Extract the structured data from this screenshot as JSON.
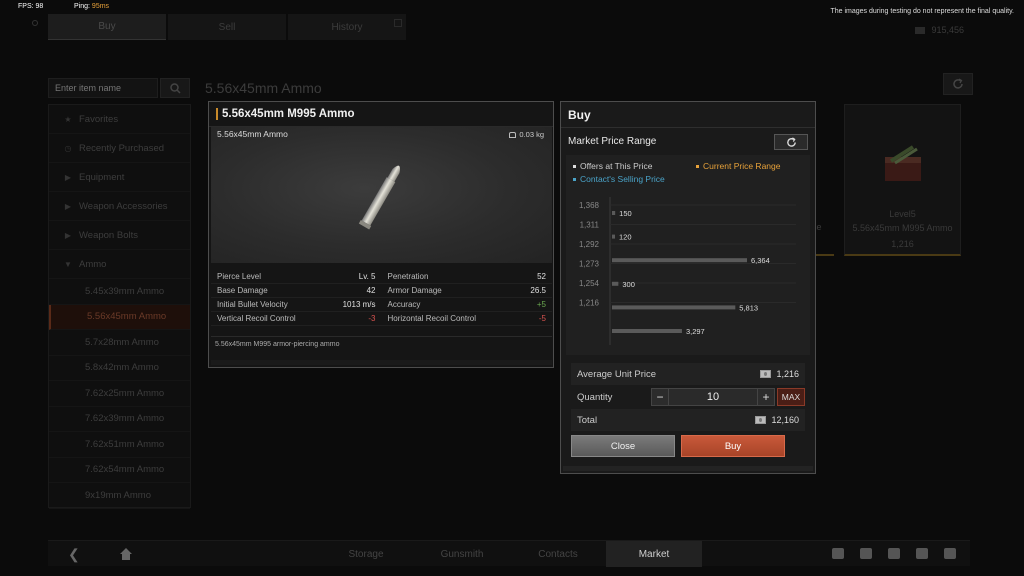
{
  "debug": {
    "fps_label": "FPS: 98",
    "ping_label": "Ping:",
    "ping_value": "95ms",
    "disclaimer": "The images during testing do not represent the final quality."
  },
  "top_tabs": [
    {
      "label": "Buy",
      "active": true
    },
    {
      "label": "Sell",
      "active": false
    },
    {
      "label": "History",
      "active": false
    }
  ],
  "balance": "915,456",
  "search": {
    "placeholder": "Enter item name"
  },
  "page_title": "5.56x45mm Ammo",
  "sidebar": {
    "items": [
      {
        "label": "Favorites",
        "icon": "star-icon"
      },
      {
        "label": "Recently Purchased",
        "icon": "clock-icon"
      },
      {
        "label": "Equipment",
        "icon": "caret-right-icon"
      },
      {
        "label": "Weapon Accessories",
        "icon": "caret-right-icon"
      },
      {
        "label": "Weapon Bolts",
        "icon": "caret-right-icon"
      },
      {
        "label": "Ammo",
        "icon": "caret-down-icon"
      }
    ],
    "ammo_items": [
      {
        "label": "5.45x39mm Ammo",
        "selected": false
      },
      {
        "label": "5.56x45mm Ammo",
        "selected": true
      },
      {
        "label": "5.7x28mm Ammo",
        "selected": false
      },
      {
        "label": "5.8x42mm Ammo",
        "selected": false
      },
      {
        "label": "7.62x25mm Ammo",
        "selected": false
      },
      {
        "label": "7.62x39mm Ammo",
        "selected": false
      },
      {
        "label": "7.62x51mm Ammo",
        "selected": false
      },
      {
        "label": "7.62x54mm Ammo",
        "selected": false
      },
      {
        "label": "9x19mm Ammo",
        "selected": false
      }
    ]
  },
  "item_card": {
    "level": "Level5",
    "name": "5.56x45mm M995 Ammo",
    "price": "1,216",
    "partial_text": "ce"
  },
  "info": {
    "title": "5.56x45mm M995 Ammo",
    "subtitle": "5.56x45mm Ammo",
    "weight": "0.03 kg",
    "stats": [
      [
        {
          "label": "Pierce Level",
          "value": "Lv. 5",
          "tone": ""
        },
        {
          "label": "Penetration",
          "value": "52",
          "tone": ""
        }
      ],
      [
        {
          "label": "Base Damage",
          "value": "42",
          "tone": ""
        },
        {
          "label": "Armor Damage",
          "value": "26.5",
          "tone": ""
        }
      ],
      [
        {
          "label": "Initial Bullet Velocity",
          "value": "1013 m/s",
          "tone": ""
        },
        {
          "label": "Accuracy",
          "value": "+5",
          "tone": "pos"
        }
      ],
      [
        {
          "label": "Vertical Recoil Control",
          "value": "-3",
          "tone": "neg"
        },
        {
          "label": "Horizontal Recoil Control",
          "value": "-5",
          "tone": "neg"
        }
      ]
    ],
    "description": "5.56x45mm M995 armor-piercing ammo"
  },
  "buy": {
    "title": "Buy",
    "market_price_range": "Market Price Range",
    "legend": {
      "offers": "Offers at This Price",
      "current": "Current Price Range",
      "contact": "Contact's Selling Price"
    },
    "average_label": "Average Unit Price",
    "average_value": "1,216",
    "quantity_label": "Quantity",
    "quantity_value": "10",
    "max_label": "MAX",
    "total_label": "Total",
    "total_value": "12,160",
    "close_label": "Close",
    "buy_label": "Buy"
  },
  "chart_data": {
    "type": "bar",
    "orientation": "horizontal",
    "y_ticks": [
      "1,368",
      "1,311",
      "1,292",
      "1,273",
      "1,254",
      "1,216"
    ],
    "bars": [
      {
        "value": 150,
        "label": "150"
      },
      {
        "value": 120,
        "label": "120"
      },
      {
        "value": 6364,
        "label": "6,364"
      },
      {
        "value": 300,
        "label": "300"
      },
      {
        "value": 5813,
        "label": "5,813"
      },
      {
        "value": 3297,
        "label": "3,297"
      }
    ],
    "xmax": 6364,
    "colors": {
      "bar": "#5a5a5a"
    }
  },
  "bottom_bar": {
    "tabs": [
      {
        "label": "Storage",
        "active": false
      },
      {
        "label": "Gunsmith",
        "active": false
      },
      {
        "label": "Contacts",
        "active": false
      },
      {
        "label": "Market",
        "active": true
      }
    ],
    "icons": [
      "document-icon",
      "chat-icon",
      "mail-icon",
      "user-icon",
      "gear-icon"
    ]
  }
}
